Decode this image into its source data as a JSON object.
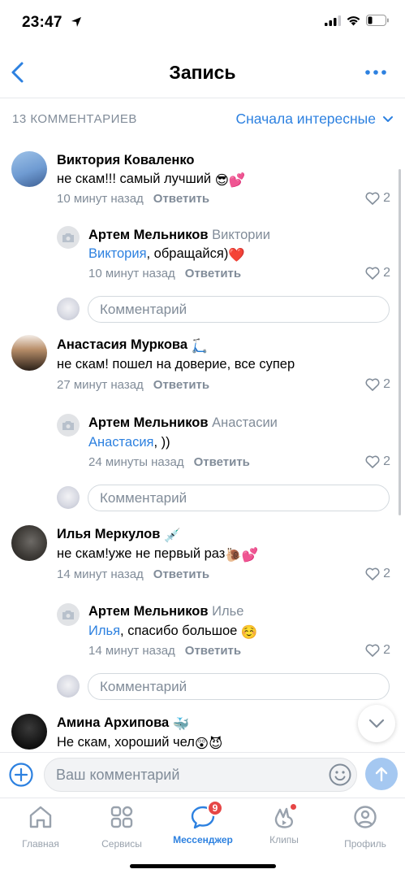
{
  "status_bar": {
    "time": "23:47"
  },
  "header": {
    "title": "Запись"
  },
  "sort": {
    "count_label": "13 КОММЕНТАРИЕВ",
    "order_label": "Сначала интересные"
  },
  "comments": [
    {
      "author": "Виктория Коваленко",
      "text": "не скам!!! самый лучший",
      "emoji": "😎💕",
      "time": "10 минут назад",
      "reply_label": "Ответить",
      "likes": "2",
      "reply": {
        "author": "Артем Мельников",
        "to": "Виктории",
        "mention": "Виктория",
        "text": ", обращайся)",
        "emoji": "❤️",
        "time": "10 минут назад",
        "reply_label": "Ответить",
        "likes": "2"
      }
    },
    {
      "author": "Анастасия Муркова",
      "author_emoji": "🛴",
      "text": "не скам! пошел на доверие, все супер",
      "time": "27 минут назад",
      "reply_label": "Ответить",
      "likes": "2",
      "reply": {
        "author": "Артем Мельников",
        "to": "Анастасии",
        "mention": "Анастасия",
        "text": ", ))",
        "time": "24 минуты назад",
        "reply_label": "Ответить",
        "likes": "2"
      }
    },
    {
      "author": "Илья Меркулов",
      "author_emoji": "💉",
      "text": "не скам!уже не первый раз",
      "emoji": "🐌💕",
      "time": "14 минут назад",
      "reply_label": "Ответить",
      "likes": "2",
      "reply": {
        "author": "Артем Мельников",
        "to": "Илье",
        "mention": "Илья",
        "text": ", спасибо большое",
        "emoji": "☺️",
        "time": "14 минут назад",
        "reply_label": "Ответить",
        "likes": "2"
      }
    },
    {
      "author": "Амина Архипова",
      "author_emoji": "🐳",
      "text": "Не скам, хороший чел",
      "emoji": "😲😈"
    }
  ],
  "comment_placeholder": "Комментарий",
  "composer": {
    "placeholder": "Ваш комментарий"
  },
  "tabbar": {
    "tabs": [
      {
        "label": "Главная"
      },
      {
        "label": "Сервисы"
      },
      {
        "label": "Мессенджер",
        "badge": "9"
      },
      {
        "label": "Клипы"
      },
      {
        "label": "Профиль"
      }
    ]
  },
  "colors": {
    "accent": "#2d81e0",
    "secondary_text": "#818c99",
    "badge": "#e64646"
  }
}
